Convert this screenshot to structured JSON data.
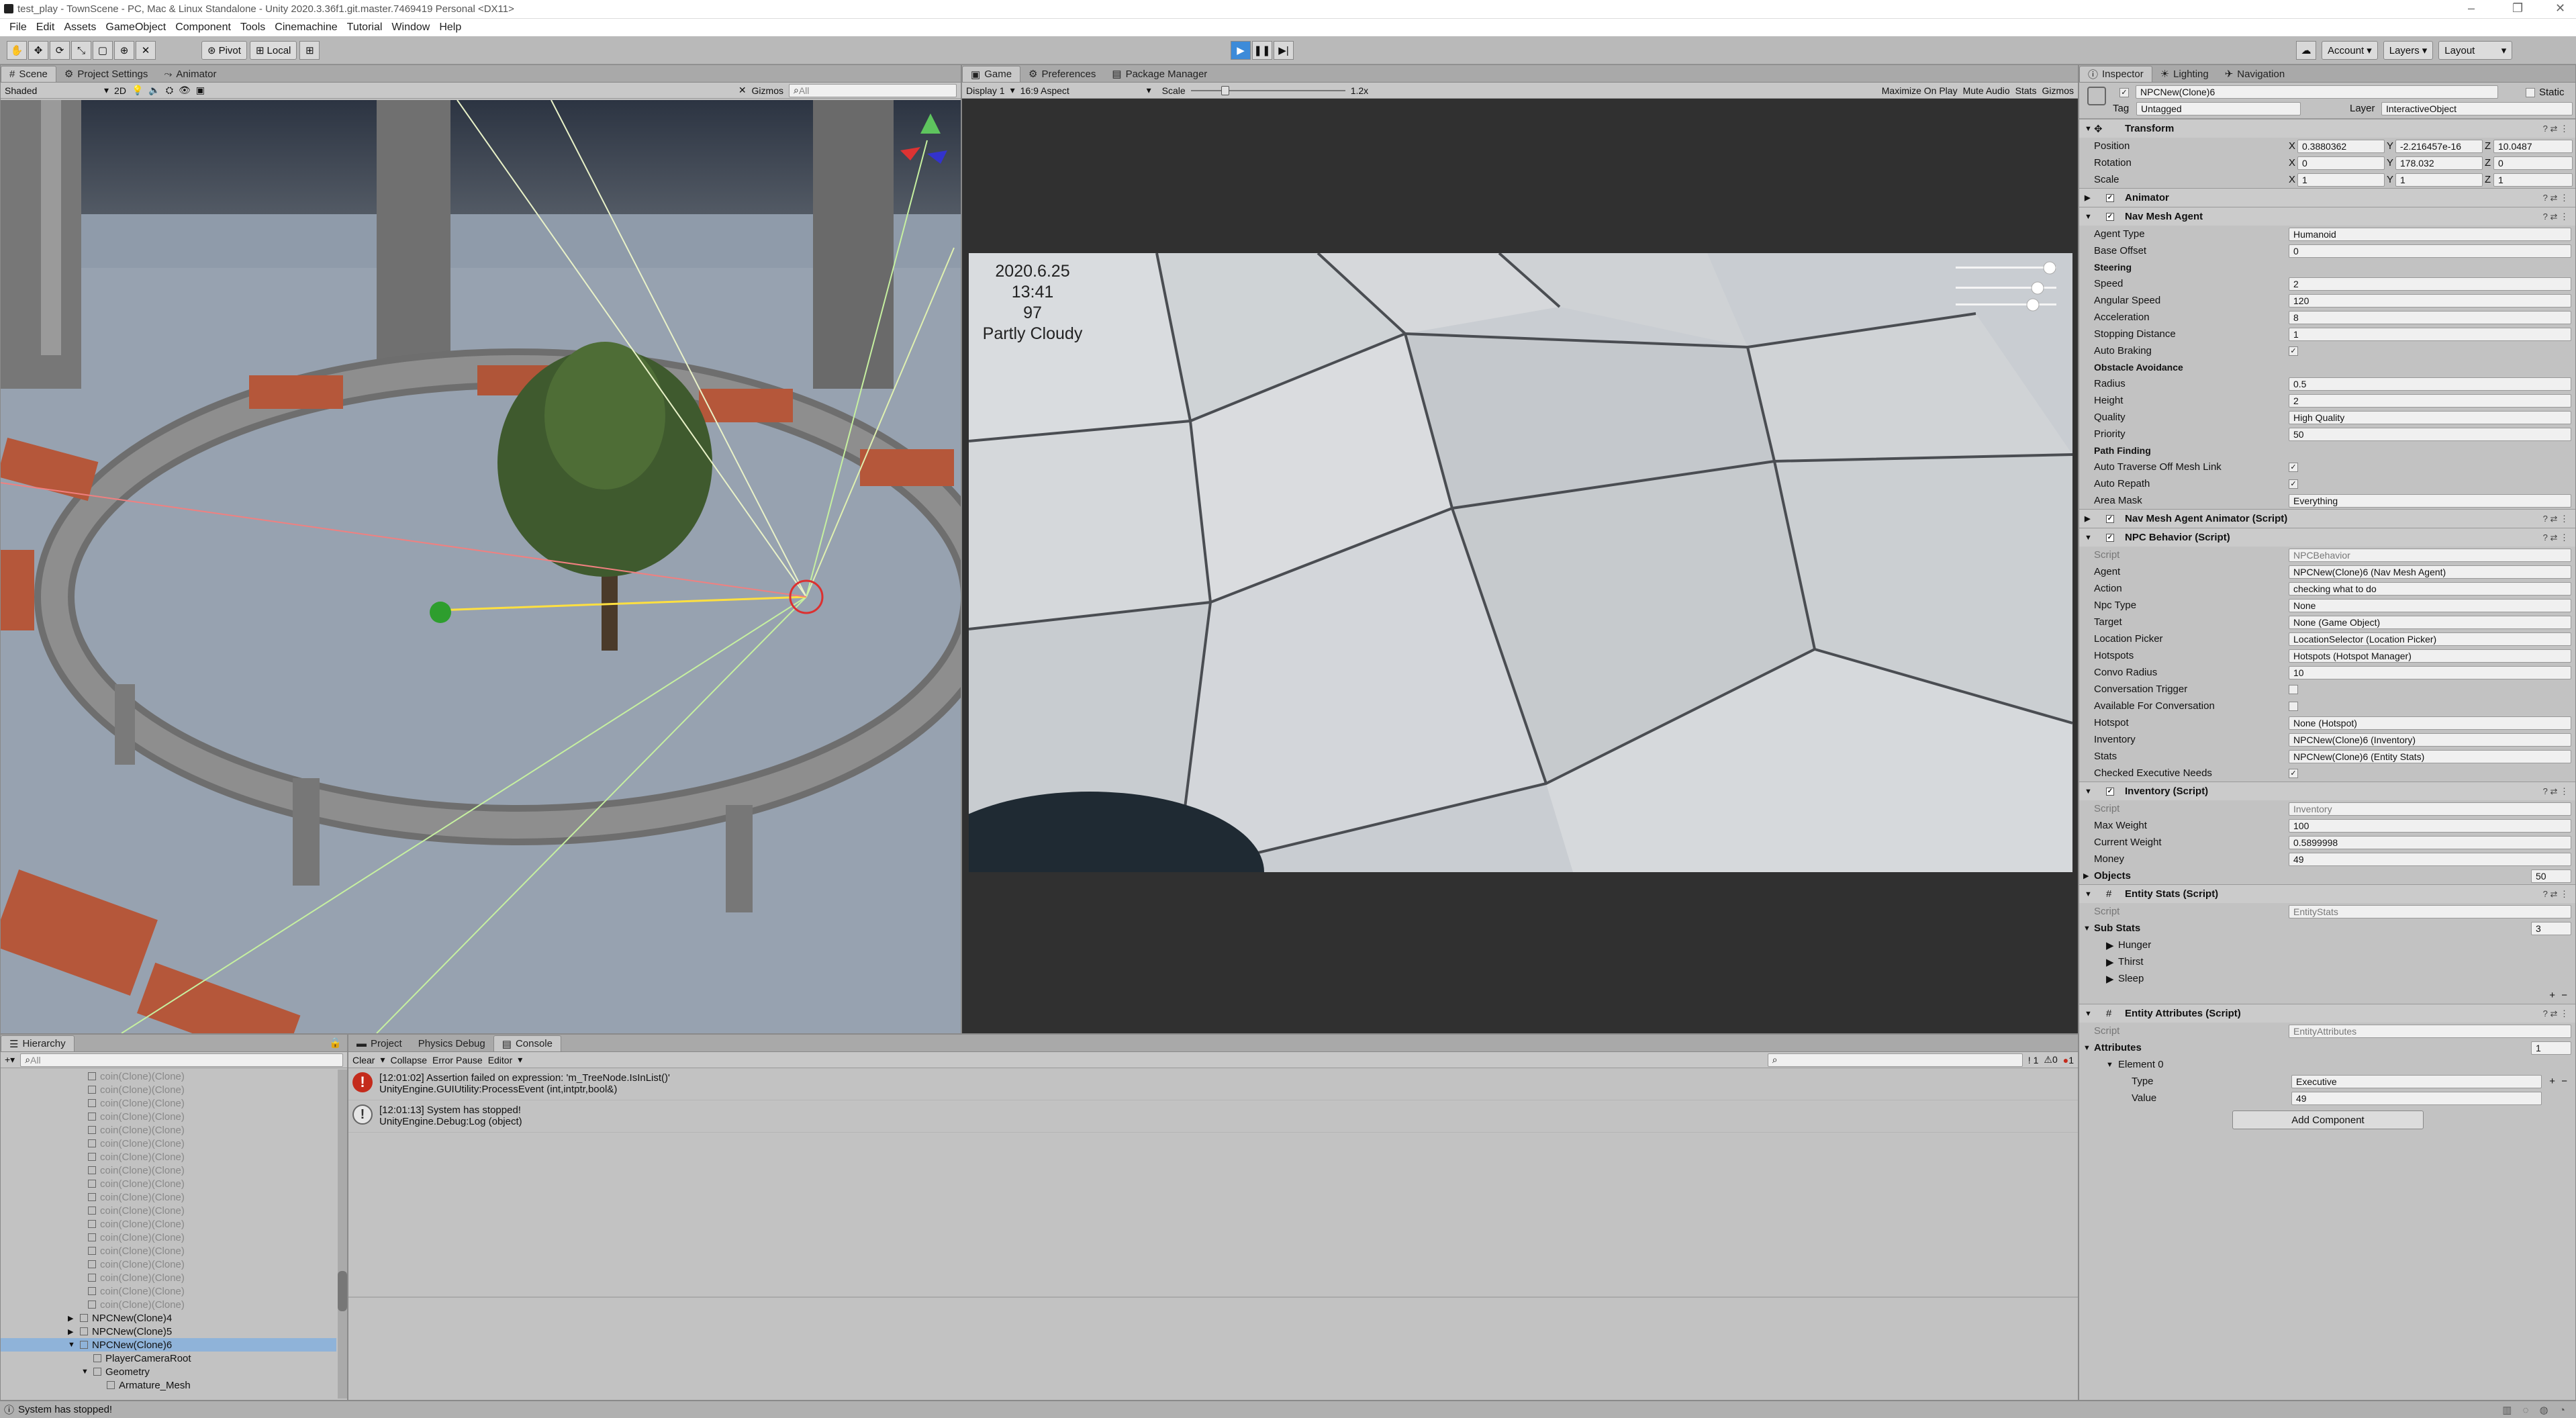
{
  "window": {
    "title": "test_play - TownScene - PC, Mac & Linux Standalone - Unity 2020.3.36f1.git.master.7469419 Personal <DX11>"
  },
  "menu": [
    "File",
    "Edit",
    "Assets",
    "GameObject",
    "Component",
    "Tools",
    "Cinemachine",
    "Tutorial",
    "Window",
    "Help"
  ],
  "toolbar": {
    "pivot": "Pivot",
    "local": "Local",
    "account": "Account",
    "layers": "Layers",
    "layout": "Layout"
  },
  "scene": {
    "tabs": [
      "Scene",
      "Project Settings",
      "Animator"
    ],
    "shading": "Shaded",
    "mode2d": "2D",
    "gizmos": "Gizmos",
    "search_placeholder": "All"
  },
  "game": {
    "tabs": [
      "Game",
      "Preferences",
      "Package Manager"
    ],
    "display": "Display 1",
    "aspect": "16:9 Aspect",
    "scale_label": "Scale",
    "scale_value": "1.2x",
    "options": [
      "Maximize On Play",
      "Mute Audio",
      "Stats",
      "Gizmos"
    ],
    "hud": {
      "date": "2020.6.25",
      "time": "13:41",
      "value": "97",
      "weather": "Partly Cloudy"
    }
  },
  "hierarchy": {
    "tab": "Hierarchy",
    "search_placeholder": "All",
    "coin_label": "coin(Clone)(Clone)",
    "items": [
      {
        "label": "NPCNew(Clone)4",
        "indent": 1,
        "arrow": "▶"
      },
      {
        "label": "NPCNew(Clone)5",
        "indent": 1,
        "arrow": "▶"
      },
      {
        "label": "NPCNew(Clone)6",
        "indent": 1,
        "arrow": "▼",
        "selected": true
      },
      {
        "label": "PlayerCameraRoot",
        "indent": 2,
        "arrow": ""
      },
      {
        "label": "Geometry",
        "indent": 2,
        "arrow": "▼"
      },
      {
        "label": "Armature_Mesh",
        "indent": 3,
        "arrow": ""
      }
    ]
  },
  "console": {
    "tabs": [
      "Project",
      "Physics Debug",
      "Console"
    ],
    "buttons": [
      "Clear",
      "Collapse",
      "Error Pause",
      "Editor"
    ],
    "counts": {
      "log": "1",
      "warn": "0",
      "error": "1"
    },
    "entries": [
      {
        "type": "error",
        "line1": "[12:01:02] Assertion failed on expression: 'm_TreeNode.IsInList()'",
        "line2": "UnityEngine.GUIUtility:ProcessEvent (int,intptr,bool&)"
      },
      {
        "type": "log",
        "line1": "[12:01:13] System has stopped!",
        "line2": "UnityEngine.Debug:Log (object)"
      }
    ]
  },
  "inspector": {
    "tabs": [
      "Inspector",
      "Lighting",
      "Navigation"
    ],
    "object_name": "NPCNew(Clone)6",
    "static_label": "Static",
    "tag_label": "Tag",
    "tag": "Untagged",
    "layer_label": "Layer",
    "layer": "InteractiveObject",
    "transform": {
      "title": "Transform",
      "position": {
        "label": "Position",
        "x": "0.3880362",
        "y": "-2.216457e-16",
        "z": "10.0487"
      },
      "rotation": {
        "label": "Rotation",
        "x": "0",
        "y": "178.032",
        "z": "0"
      },
      "scale": {
        "label": "Scale",
        "x": "1",
        "y": "1",
        "z": "1"
      }
    },
    "animator_title": "Animator",
    "navmesh": {
      "title": "Nav Mesh Agent",
      "rows1": [
        {
          "label": "Agent Type",
          "value": "Humanoid"
        },
        {
          "label": "Base Offset",
          "value": "0"
        }
      ],
      "steering": "Steering",
      "rows2": [
        {
          "label": "Speed",
          "value": "2"
        },
        {
          "label": "Angular Speed",
          "value": "120"
        },
        {
          "label": "Acceleration",
          "value": "8"
        },
        {
          "label": "Stopping Distance",
          "value": "1"
        },
        {
          "label": "Auto Braking",
          "value": "✓"
        }
      ],
      "obstacle": "Obstacle Avoidance",
      "rows3": [
        {
          "label": "Radius",
          "value": "0.5"
        },
        {
          "label": "Height",
          "value": "2"
        },
        {
          "label": "Quality",
          "value": "High Quality"
        },
        {
          "label": "Priority",
          "value": "50"
        }
      ],
      "pathfinding": "Path Finding",
      "rows4": [
        {
          "label": "Auto Traverse Off Mesh Link",
          "value": "✓"
        },
        {
          "label": "Auto Repath",
          "value": "✓"
        },
        {
          "label": "Area Mask",
          "value": "Everything"
        }
      ]
    },
    "navmesh_animator_title": "Nav Mesh Agent Animator (Script)",
    "npc_behavior": {
      "title": "NPC Behavior (Script)",
      "rows": [
        {
          "label": "Script",
          "value": "NPCBehavior"
        },
        {
          "label": "Agent",
          "value": "NPCNew(Clone)6 (Nav Mesh Agent)"
        },
        {
          "label": "Action",
          "value": "checking what to do"
        },
        {
          "label": "Npc Type",
          "value": "None"
        },
        {
          "label": "Target",
          "value": "None (Game Object)"
        },
        {
          "label": "Location Picker",
          "value": "LocationSelector (Location Picker)"
        },
        {
          "label": "Hotspots",
          "value": "Hotspots (Hotspot Manager)"
        },
        {
          "label": "Convo Radius",
          "value": "10"
        },
        {
          "label": "Conversation Trigger",
          "value": ""
        },
        {
          "label": "Available For Conversation",
          "value": ""
        },
        {
          "label": "Hotspot",
          "value": "None (Hotspot)"
        },
        {
          "label": "Inventory",
          "value": "NPCNew(Clone)6 (Inventory)"
        },
        {
          "label": "Stats",
          "value": "NPCNew(Clone)6 (Entity Stats)"
        },
        {
          "label": "Checked Executive Needs",
          "value": "✓"
        }
      ]
    },
    "inventory": {
      "title": "Inventory (Script)",
      "rows": [
        {
          "label": "Script",
          "value": "Inventory"
        },
        {
          "label": "Max Weight",
          "value": "100"
        },
        {
          "label": "Current Weight",
          "value": "0.5899998"
        },
        {
          "label": "Money",
          "value": "49"
        }
      ],
      "objects_label": "Objects",
      "objects_count": "50"
    },
    "entity_stats": {
      "title": "Entity Stats (Script)",
      "script_label": "Script",
      "script": "EntityStats",
      "substats_label": "Sub Stats",
      "substats_count": "3",
      "items": [
        "Hunger",
        "Thirst",
        "Sleep"
      ]
    },
    "entity_attributes": {
      "title": "Entity Attributes (Script)",
      "script_label": "Script",
      "script": "EntityAttributes",
      "attributes_label": "Attributes",
      "attributes_count": "1",
      "element": "Element 0",
      "type_label": "Type",
      "type": "Executive",
      "value_label": "Value",
      "value": "49"
    },
    "add_component": "Add Component"
  },
  "status": {
    "text": "System has stopped!"
  }
}
